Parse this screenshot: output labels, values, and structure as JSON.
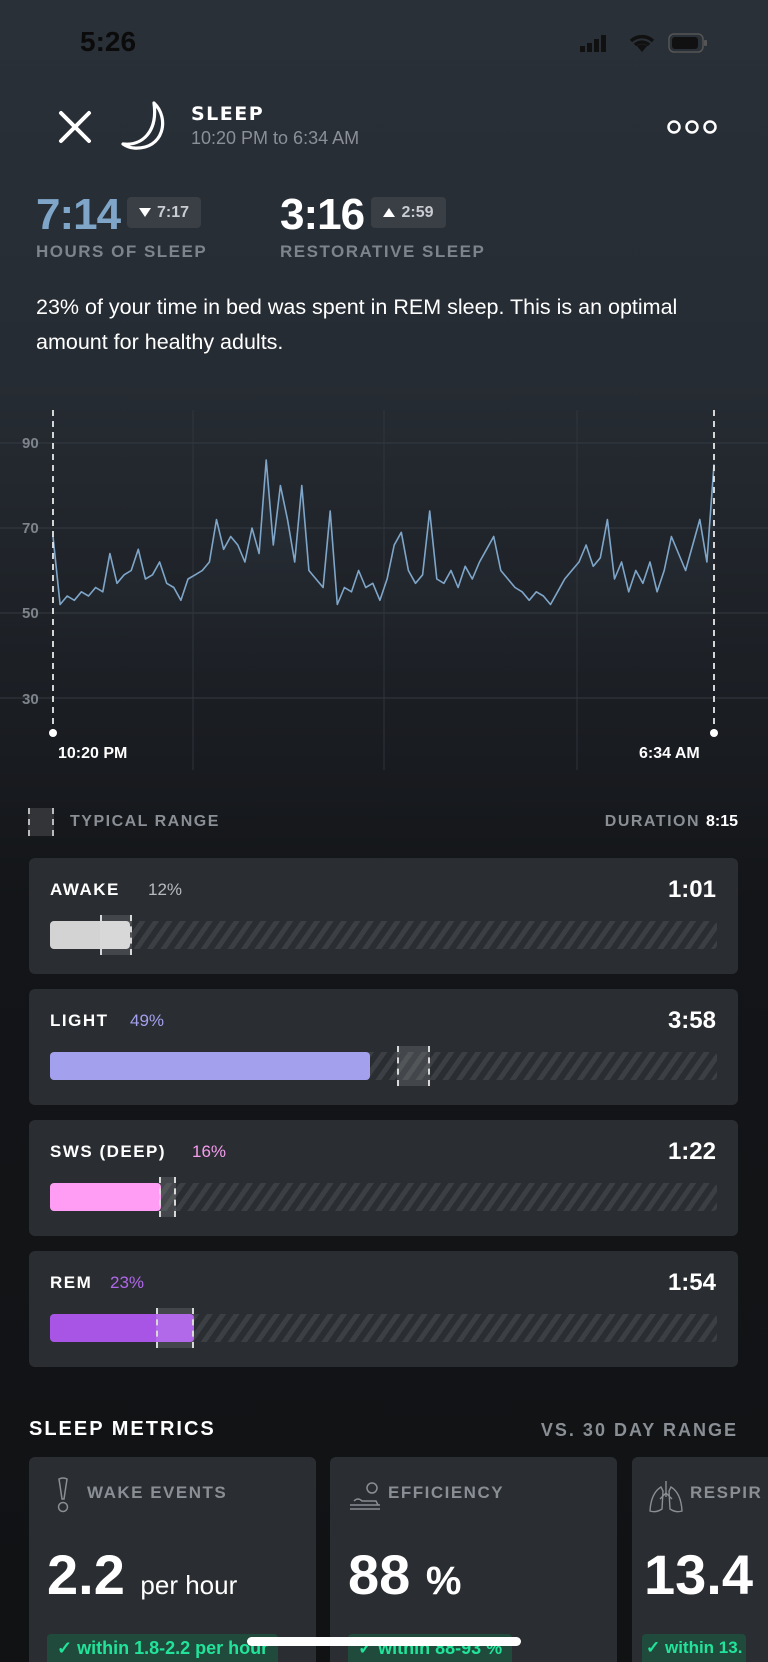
{
  "status_bar": {
    "time": "5:26"
  },
  "header": {
    "title": "SLEEP",
    "subtitle": "10:20 PM to 6:34 AM",
    "close_icon": "close-icon",
    "moon_icon": "moon-icon",
    "more_icon": "more-icon"
  },
  "summary": {
    "hours_of_sleep": {
      "value": "7:14",
      "compare": "7:17",
      "direction": "down",
      "label": "HOURS OF SLEEP",
      "color": "#7fa6c9"
    },
    "restorative_sleep": {
      "value": "3:16",
      "compare": "2:59",
      "direction": "up",
      "label": "RESTORATIVE SLEEP"
    }
  },
  "description": "23% of your time in bed was spent in REM sleep. This is an optimal amount for healthy adults.",
  "chart_data": {
    "type": "line",
    "y_ticks": [
      "90",
      "70",
      "50",
      "30"
    ],
    "ylim": [
      30,
      90
    ],
    "x_start": "10:20 PM",
    "x_end": "6:34 AM",
    "grid": true,
    "line_color": "#7fa6c9",
    "values": [
      68,
      52,
      54,
      53,
      55,
      54,
      56,
      55,
      64,
      57,
      59,
      60,
      65,
      58,
      59,
      62,
      57,
      56,
      53,
      58,
      59,
      60,
      62,
      72,
      65,
      68,
      66,
      62,
      70,
      64,
      86,
      66,
      80,
      72,
      62,
      80,
      60,
      58,
      56,
      74,
      52,
      56,
      55,
      60,
      56,
      57,
      53,
      58,
      66,
      69,
      60,
      57,
      59,
      74,
      58,
      57,
      60,
      56,
      61,
      58,
      62,
      65,
      68,
      60,
      58,
      56,
      55,
      53,
      55,
      54,
      52,
      55,
      58,
      60,
      62,
      66,
      61,
      63,
      72,
      58,
      62,
      55,
      60,
      57,
      62,
      55,
      60,
      68,
      64,
      60,
      66,
      72,
      62,
      85
    ]
  },
  "legend": {
    "typical_range": "TYPICAL RANGE",
    "duration_label": "DURATION",
    "duration_value": "8:15"
  },
  "stages": [
    {
      "name": "AWAKE",
      "percent": "12%",
      "duration": "1:01",
      "fill_percent": 12,
      "range_percent": [
        7.5,
        12.3
      ],
      "color": "#d3d3d3",
      "pct_color": "#b8bbbf"
    },
    {
      "name": "LIGHT",
      "percent": "49%",
      "duration": "3:58",
      "fill_percent": 48,
      "range_percent": [
        52,
        57
      ],
      "color": "#a3a0ee",
      "pct_color": "#a3a0ee"
    },
    {
      "name": "SWS (DEEP)",
      "percent": "16%",
      "duration": "1:22",
      "fill_percent": 16.6,
      "range_percent": [
        16.3,
        18.9
      ],
      "color": "#ff9cf4",
      "pct_color": "#f59ded"
    },
    {
      "name": "REM",
      "percent": "23%",
      "duration": "1:54",
      "fill_percent": 21.6,
      "range_percent": [
        15.9,
        21.6
      ],
      "color": "#a855e6",
      "pct_color": "#b167ea"
    }
  ],
  "metrics": {
    "title": "SLEEP METRICS",
    "compare_label": "VS. 30 DAY RANGE",
    "cards": [
      {
        "label": "WAKE EVENTS",
        "icon": "exclamation-icon",
        "value": "2.2",
        "unit": "per hour",
        "range": "✓ within 1.8-2.2 per hour"
      },
      {
        "label": "EFFICIENCY",
        "icon": "bed-icon",
        "value": "88",
        "unit": "%",
        "range": "✓ within 88-93 %"
      },
      {
        "label": "RESPIR",
        "icon": "lungs-icon",
        "value": "13.4",
        "unit": "",
        "range": "✓ within 13."
      }
    ]
  }
}
